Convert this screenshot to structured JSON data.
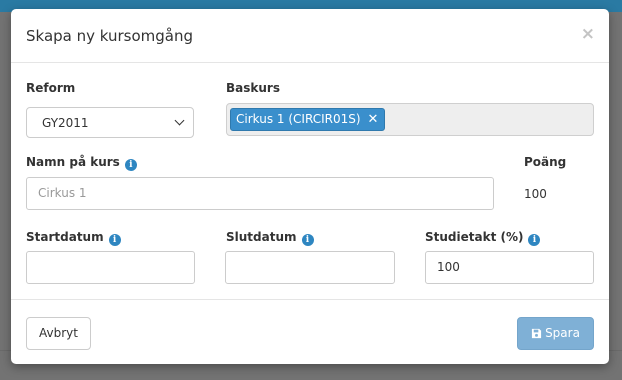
{
  "modal": {
    "title": "Skapa ny kursomgång",
    "close_glyph": "×"
  },
  "form": {
    "reform": {
      "label": "Reform",
      "selected": "GY2011"
    },
    "baskurs": {
      "label": "Baskurs",
      "tags": [
        {
          "text": "Cirkus 1 (CIRCIR01S)",
          "remove_glyph": "✕"
        }
      ]
    },
    "namn": {
      "label": "Namn på kurs",
      "placeholder": "Cirkus 1",
      "value": ""
    },
    "poang": {
      "label": "Poäng",
      "value": "100"
    },
    "startdatum": {
      "label": "Startdatum",
      "value": ""
    },
    "slutdatum": {
      "label": "Slutdatum",
      "value": ""
    },
    "studietakt": {
      "label": "Studietakt (%)",
      "value": "100"
    },
    "info_glyph": "i"
  },
  "footer": {
    "cancel_label": "Avbryt",
    "save_label": "Spara",
    "save_icon": "floppy-disk-icon"
  },
  "colors": {
    "primary": "#3a8fcc",
    "primary_disabled": "#7fb0d6",
    "info": "#2e86c1",
    "backdrop": "#737373"
  }
}
